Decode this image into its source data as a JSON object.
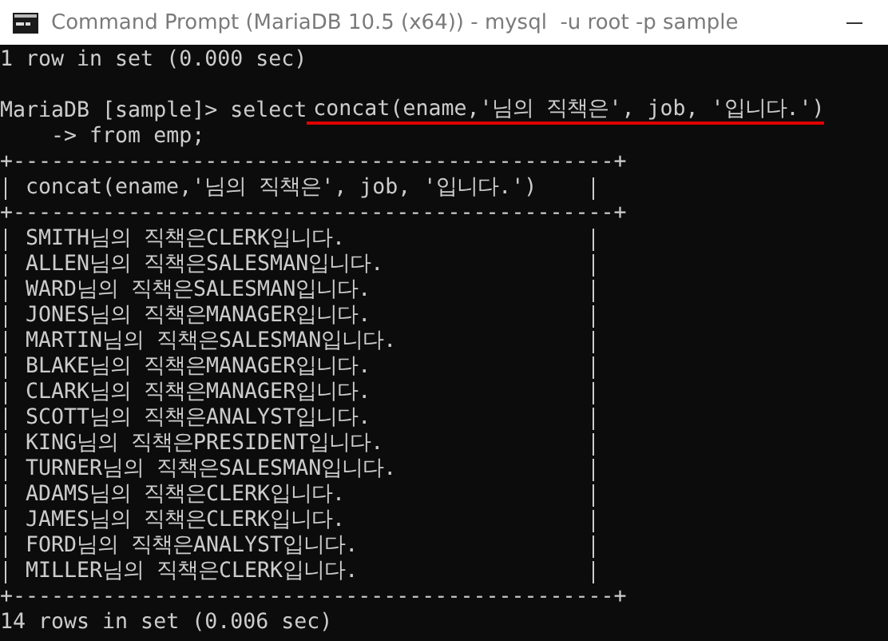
{
  "window": {
    "title": "Command Prompt (MariaDB 10.5 (x64)) - mysql  -u root -p sample"
  },
  "console": {
    "lines": [
      {
        "kind": "text",
        "text": "1 row in set (0.000 sec)"
      },
      {
        "kind": "blank"
      },
      {
        "kind": "prompt",
        "prompt": "MariaDB [sample]>",
        "command": "select",
        "argument": "concat(ename,'님의 직책은', job, '입니다.')",
        "underlined": true
      },
      {
        "kind": "text",
        "text": "    -> from emp;"
      }
    ],
    "table": {
      "top_border": "+-----------------------------------------------+",
      "header": "concat(ename,'님의 직책은', job, '입니다.')",
      "header_border": "+-----------------------------------------------+",
      "rows": [
        "SMITH님의 직책은CLERK입니다.",
        "ALLEN님의 직책은SALESMAN입니다.",
        "WARD님의 직책은SALESMAN입니다.",
        "JONES님의 직책은MANAGER입니다.",
        "MARTIN님의 직책은SALESMAN입니다.",
        "BLAKE님의 직책은MANAGER입니다.",
        "CLARK님의 직책은MANAGER입니다.",
        "SCOTT님의 직책은ANALYST입니다.",
        "KING님의 직책은PRESIDENT입니다.",
        "TURNER님의 직책은SALESMAN입니다.",
        "ADAMS님의 직책은CLERK입니다.",
        "JAMES님의 직책은CLERK입니다.",
        "FORD님의 직책은ANALYST입니다.",
        "MILLER님의 직책은CLERK입니다."
      ],
      "bottom_border": "+-----------------------------------------------+"
    },
    "footer": "14 rows in set (0.006 sec)"
  }
}
